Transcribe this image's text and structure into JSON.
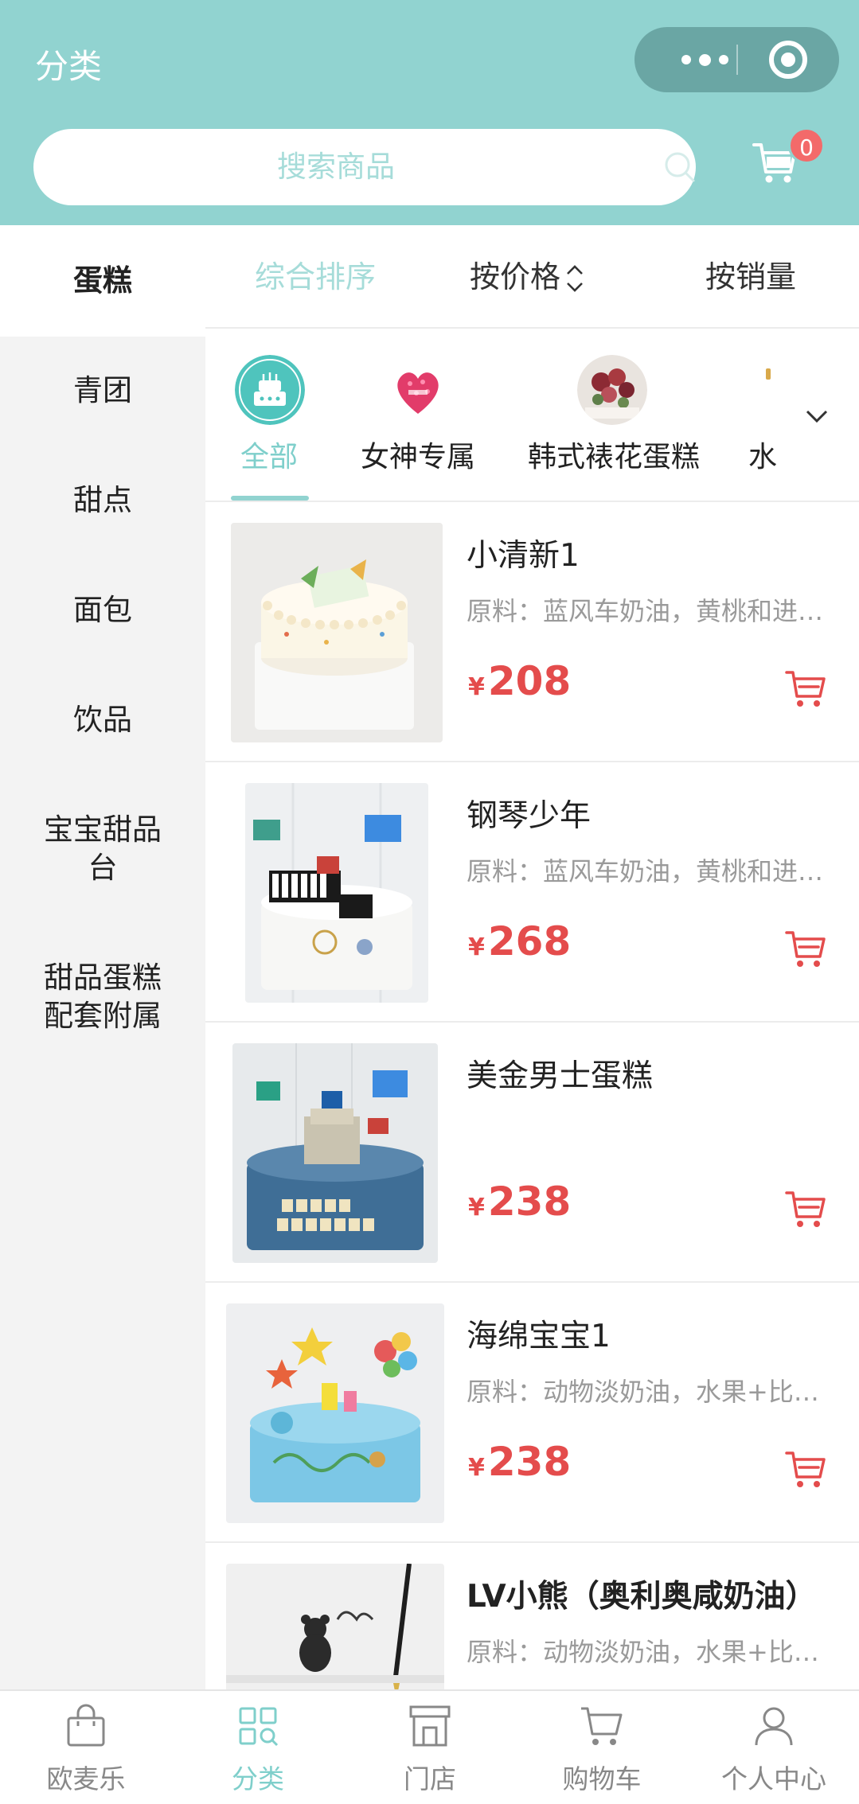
{
  "header": {
    "title": "分类",
    "search_placeholder": "搜索商品",
    "cart_badge": "0"
  },
  "sidebar": {
    "items": [
      {
        "label": "蛋糕",
        "active": true
      },
      {
        "label": "青团"
      },
      {
        "label": "甜点"
      },
      {
        "label": "面包"
      },
      {
        "label": "饮品"
      },
      {
        "label": "宝宝甜品台"
      },
      {
        "label": "甜品蛋糕配套附属"
      }
    ]
  },
  "sort": {
    "options": [
      "综合排序",
      "按价格",
      "按销量"
    ],
    "active_index": 0
  },
  "subcategories": [
    {
      "label": "全部",
      "active": true
    },
    {
      "label": "女神专属"
    },
    {
      "label": "韩式裱花蛋糕"
    },
    {
      "label": "水"
    }
  ],
  "products": [
    {
      "name": "小清新1",
      "desc": "原料：蓝风车奶油，黄桃和进…",
      "currency": "¥",
      "price": "208"
    },
    {
      "name": "钢琴少年",
      "desc": "原料：蓝风车奶油，黄桃和进…",
      "currency": "¥",
      "price": "268"
    },
    {
      "name": "美金男士蛋糕",
      "desc": "",
      "currency": "¥",
      "price": "238"
    },
    {
      "name": "海绵宝宝1",
      "desc": "原料：动物淡奶油，水果+比…",
      "currency": "¥",
      "price": "238"
    },
    {
      "name": "LV小熊（奥利奥咸奶油）",
      "desc": "原料：动物淡奶油，水果+比…",
      "currency": "¥",
      "price": ""
    }
  ],
  "tabbar": {
    "items": [
      {
        "label": "欧麦乐",
        "icon": "bag-icon"
      },
      {
        "label": "分类",
        "icon": "grid-icon",
        "active": true
      },
      {
        "label": "门店",
        "icon": "store-icon"
      },
      {
        "label": "购物车",
        "icon": "cart-icon"
      },
      {
        "label": "个人中心",
        "icon": "person-icon"
      }
    ]
  },
  "colors": {
    "header_bg": "#91d3d0",
    "accent": "#7fcfcb",
    "price": "#e44c4c",
    "badge": "#f36a6a"
  }
}
